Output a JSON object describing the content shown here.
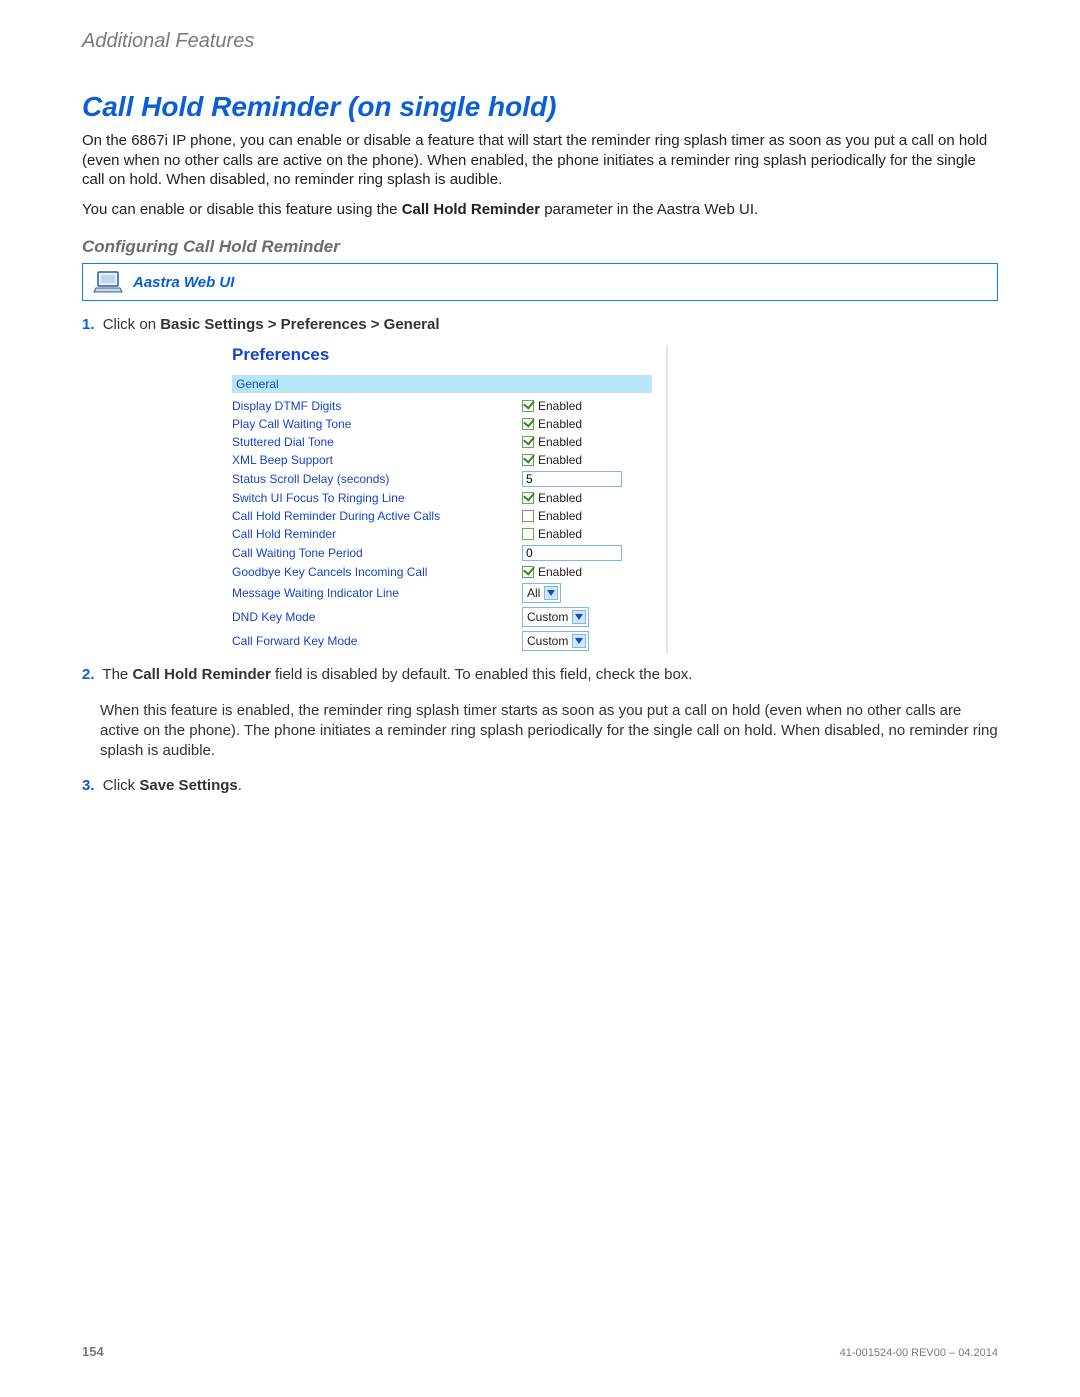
{
  "header": "Additional Features",
  "title": "Call Hold Reminder (on single hold)",
  "intro1": "On the 6867i IP phone, you can enable or disable a feature that will start the reminder ring splash timer as soon as you put a call on hold (even when no other calls are active on the phone). When enabled, the phone initiates a reminder ring splash periodically for the single call on hold. When disabled, no reminder ring splash is audible.",
  "intro2_a": "You can enable or disable this feature using the ",
  "intro2_b": "Call Hold Reminder",
  "intro2_c": " parameter in the Aastra Web UI.",
  "subhead": "Configuring Call Hold Reminder",
  "webui_label": "Aastra Web UI",
  "step1_num": "1.",
  "step1_a": "Click on ",
  "step1_b": "Basic Settings > Preferences > General",
  "prefs": {
    "title": "Preferences",
    "section": "General",
    "rows": [
      {
        "label": "Display DTMF Digits",
        "type": "checkbox",
        "checked": true,
        "text": "Enabled"
      },
      {
        "label": "Play Call Waiting Tone",
        "type": "checkbox",
        "checked": true,
        "text": "Enabled"
      },
      {
        "label": "Stuttered Dial Tone",
        "type": "checkbox",
        "checked": true,
        "text": "Enabled"
      },
      {
        "label": "XML Beep Support",
        "type": "checkbox",
        "checked": true,
        "text": "Enabled"
      },
      {
        "label": "Status Scroll Delay (seconds)",
        "type": "input",
        "value": "5"
      },
      {
        "label": "Switch UI Focus To Ringing Line",
        "type": "checkbox",
        "checked": true,
        "text": "Enabled"
      },
      {
        "label": "Call Hold Reminder During Active Calls",
        "type": "checkbox",
        "checked": false,
        "text": "Enabled"
      },
      {
        "label": "Call Hold Reminder",
        "type": "checkbox",
        "checked": false,
        "text": "Enabled"
      },
      {
        "label": "Call Waiting Tone Period",
        "type": "input",
        "value": "0"
      },
      {
        "label": "Goodbye Key Cancels Incoming Call",
        "type": "checkbox",
        "checked": true,
        "text": "Enabled"
      },
      {
        "label": "Message Waiting Indicator Line",
        "type": "select",
        "value": "All"
      },
      {
        "label": "DND Key Mode",
        "type": "select",
        "value": "Custom"
      },
      {
        "label": "Call Forward Key Mode",
        "type": "select",
        "value": "Custom"
      }
    ]
  },
  "step2_num": "2.",
  "step2_a": "The ",
  "step2_b": "Call Hold Reminder",
  "step2_c": " field is disabled by default. To enabled this field, check the box.",
  "step2_body": "When this feature is enabled, the reminder ring splash timer starts as soon as you put a call on hold (even when no other calls are active on the phone). The phone initiates a reminder ring splash periodically for the single call on hold. When disabled, no reminder ring splash is audible.",
  "step3_num": "3.",
  "step3_a": "Click ",
  "step3_b": "Save Settings",
  "step3_c": ".",
  "footer_page": "154",
  "footer_doc": "41-001524-00 REV00 – 04.2014"
}
